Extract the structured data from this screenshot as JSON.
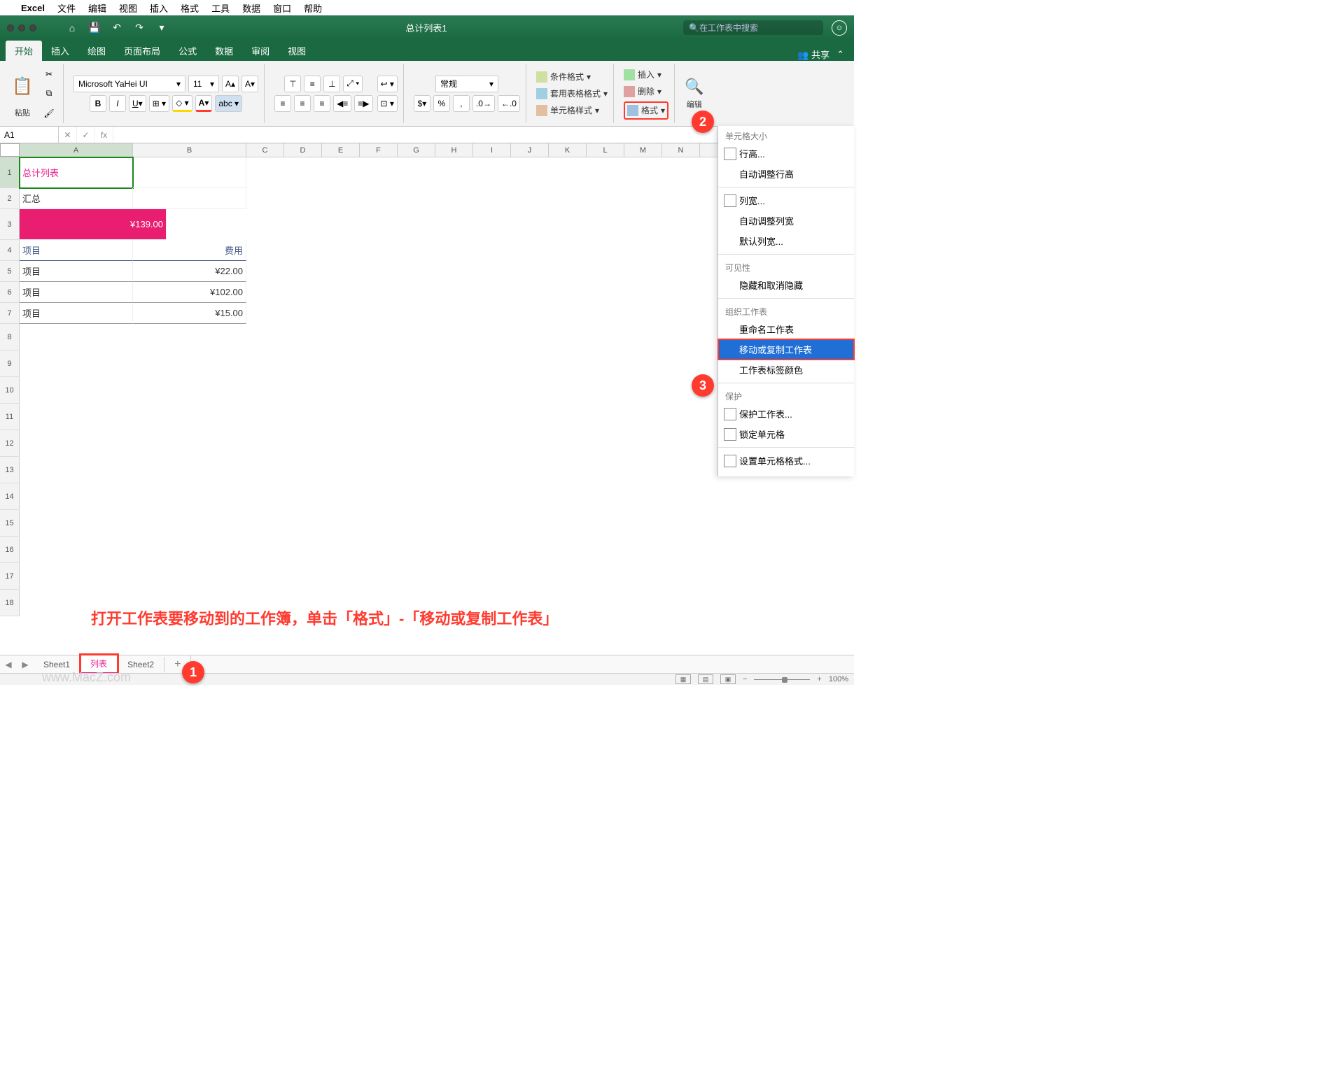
{
  "mac_menu": {
    "app": "Excel",
    "items": [
      "文件",
      "编辑",
      "视图",
      "插入",
      "格式",
      "工具",
      "数据",
      "窗口",
      "帮助"
    ]
  },
  "titlebar": {
    "title": "总计列表1",
    "search_placeholder": "在工作表中搜索"
  },
  "ribbon_tabs": [
    "开始",
    "插入",
    "绘图",
    "页面布局",
    "公式",
    "数据",
    "审阅",
    "视图"
  ],
  "share": "共享",
  "ribbon": {
    "paste": "粘贴",
    "font_name": "Microsoft YaHei UI",
    "font_size": "11",
    "number_format": "常规",
    "cond_format": "条件格式",
    "table_format": "套用表格格式",
    "cell_style": "单元格样式",
    "insert": "插入",
    "delete": "删除",
    "format": "格式",
    "edit": "编辑"
  },
  "formula": {
    "namebox": "A1",
    "fx": "fx"
  },
  "columns": [
    "A",
    "B",
    "C",
    "D",
    "E",
    "F",
    "G",
    "H",
    "I",
    "J",
    "K",
    "L",
    "M",
    "N"
  ],
  "rows": [
    "1",
    "2",
    "3",
    "4",
    "5",
    "6",
    "7",
    "8",
    "9",
    "10",
    "11",
    "12",
    "13",
    "14",
    "15",
    "16",
    "17",
    "18"
  ],
  "cells": {
    "title": "总计列表",
    "summary_label": "汇总",
    "total": "¥139.00",
    "hdr_item": "项目",
    "hdr_cost": "费用",
    "r5_item": "项目",
    "r5_cost": "¥22.00",
    "r6_item": "项目",
    "r6_cost": "¥102.00",
    "r7_item": "项目",
    "r7_cost": "¥15.00"
  },
  "format_menu": {
    "section1": "单元格大小",
    "row_height": "行高...",
    "autofit_row": "自动调整行高",
    "col_width": "列宽...",
    "autofit_col": "自动调整列宽",
    "default_width": "默认列宽...",
    "section2": "可见性",
    "hide": "隐藏和取消隐藏",
    "section3": "组织工作表",
    "rename": "重命名工作表",
    "move_copy": "移动或复制工作表",
    "tab_color": "工作表标签颜色",
    "section4": "保护",
    "protect": "保护工作表...",
    "lock": "锁定单元格",
    "cell_format": "设置单元格格式..."
  },
  "sheet_tabs": [
    "Sheet1",
    "列表",
    "Sheet2"
  ],
  "annotation": "打开工作表要移动到的工作簿，单击「格式」-「移动或复制工作表」",
  "statusbar": {
    "zoom": "100%"
  },
  "watermark": "www.MacZ.com",
  "circles": {
    "c1": "1",
    "c2": "2",
    "c3": "3"
  }
}
